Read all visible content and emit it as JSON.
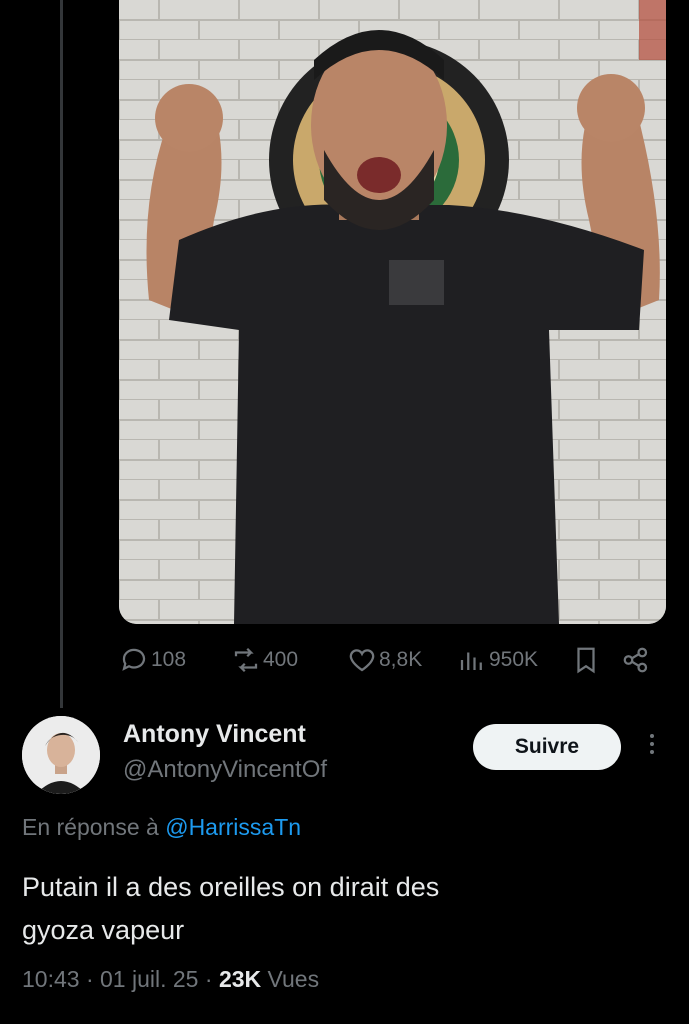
{
  "post": {
    "image_alt": "photo",
    "stats": {
      "replies": "108",
      "reposts": "400",
      "likes": "8,8K",
      "views": "950K"
    }
  },
  "reply": {
    "author_name": "Antony Vincent",
    "author_handle": "@AntonyVincentOf",
    "follow_label": "Suivre",
    "in_reply_prefix": "En réponse à",
    "in_reply_handle": "@HarrissaTn",
    "text_line1": "Putain il a des oreilles on dirait des",
    "text_line2": "gyoza vapeur",
    "time": "10:43",
    "date": "01 juil. 25",
    "views_count": "23K",
    "views_label": "Vues"
  },
  "icons": {
    "reply": "comment-icon",
    "repost": "repost-icon",
    "like": "heart-icon",
    "views": "views-chart-icon",
    "bookmark": "bookmark-icon",
    "share": "share-icon",
    "more": "more-vertical-icon"
  },
  "colors": {
    "background": "#000000",
    "text": "#e7e9ea",
    "muted": "#71767b",
    "link": "#1d9bf0",
    "button_bg": "#eff3f4"
  }
}
